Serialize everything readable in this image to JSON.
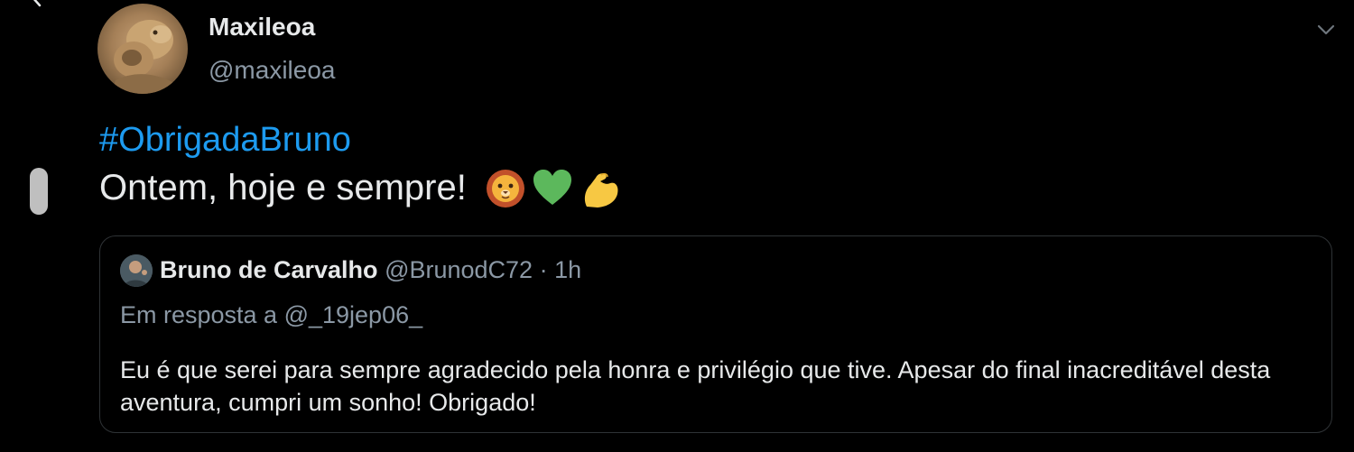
{
  "tweet": {
    "author": {
      "display_name": "Maxileoa",
      "handle": "@maxileoa",
      "avatar": "lioness-avatar"
    },
    "hashtag": "#ObrigadaBruno",
    "text": "Ontem, hoje e sempre!",
    "emojis": [
      "lion-face-emoji",
      "green-heart-emoji",
      "flexed-biceps-emoji"
    ],
    "menu_icon": "chevron-down-icon"
  },
  "quoted_tweet": {
    "author": {
      "display_name": "Bruno de Carvalho",
      "handle": "@BrunodC72",
      "avatar": "bruno-avatar"
    },
    "separator": " · ",
    "time": "1h",
    "replying_to": "Em resposta a @_19jep06_",
    "text": "Eu é que serei para sempre agradecido pela honra e privilégio que tive. Apesar do final inacreditável desta aventura, cumpri um sonho! Obrigado!"
  },
  "colors": {
    "background": "#000000",
    "primary_text": "#e7e9ea",
    "secondary_text": "#8b98a5",
    "link": "#1d9bf0",
    "border": "#2f3336"
  }
}
